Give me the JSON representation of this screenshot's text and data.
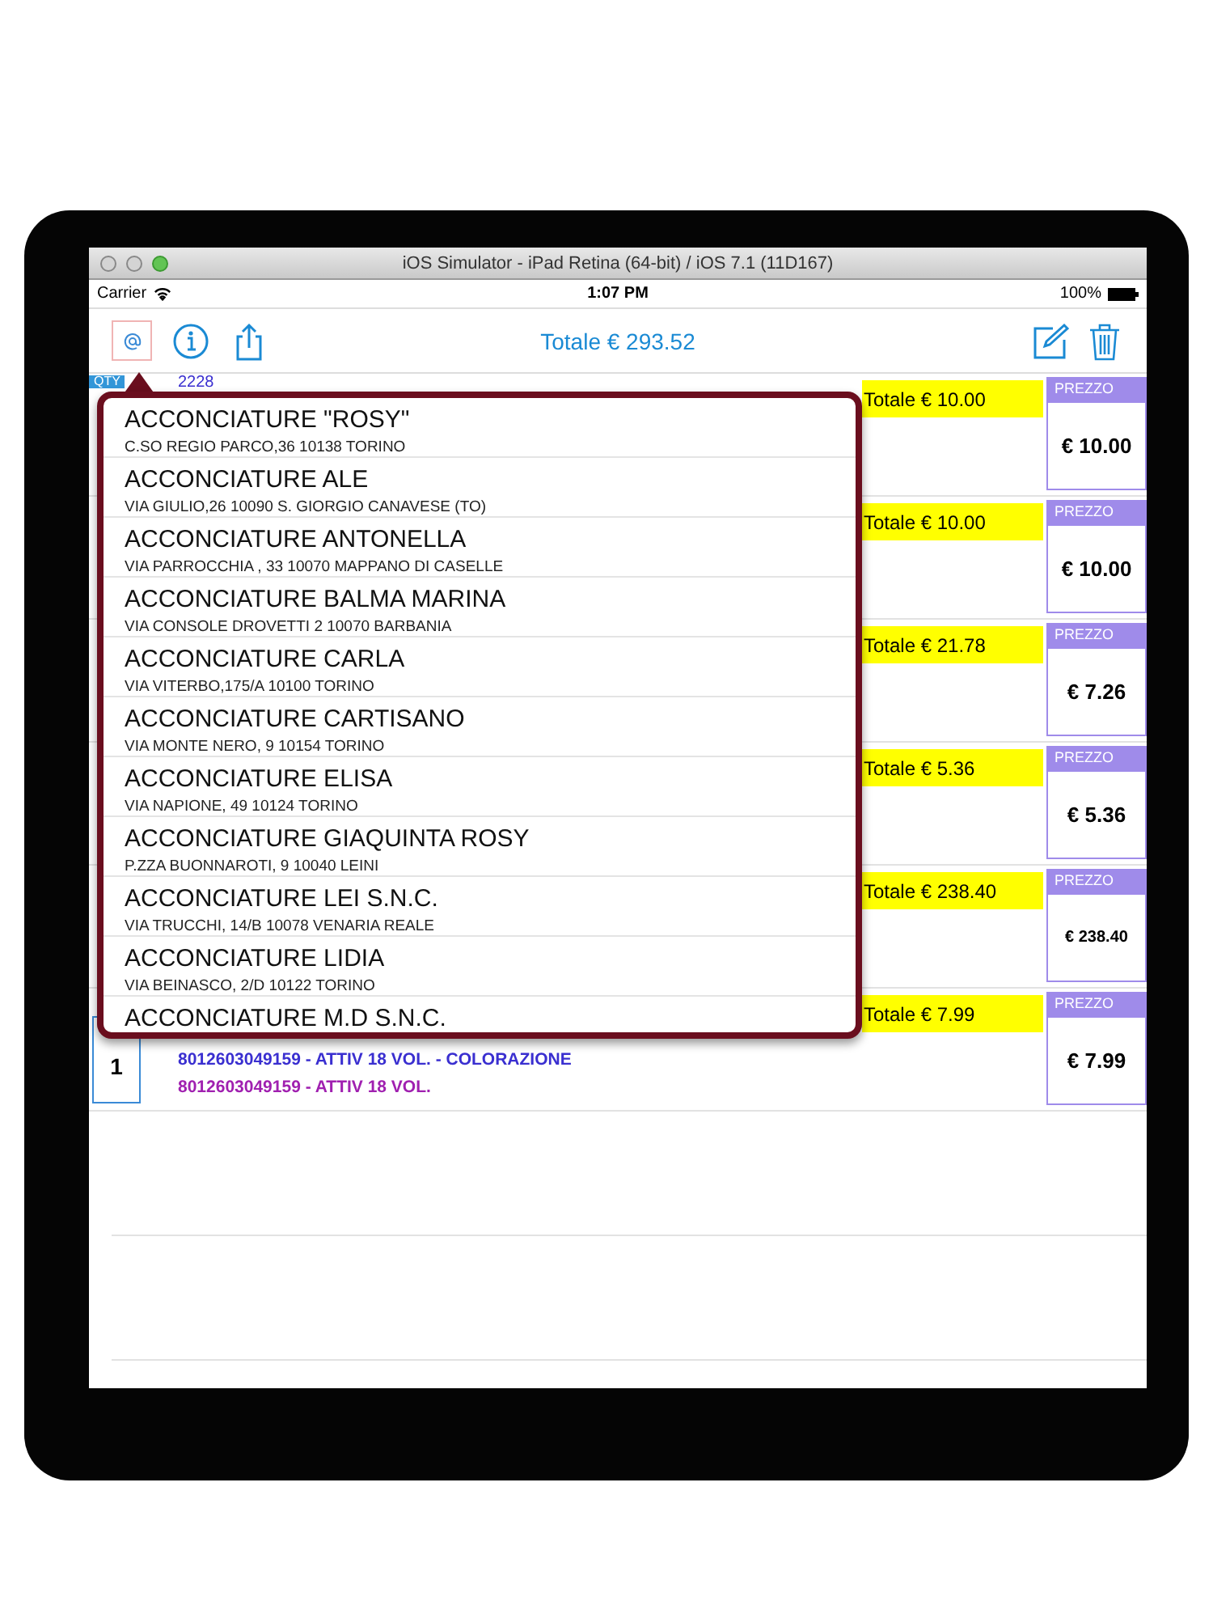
{
  "window": {
    "title": "iOS Simulator - iPad Retina (64-bit) / iOS 7.1 (11D167)"
  },
  "status_bar": {
    "carrier": "Carrier",
    "time": "1:07 PM",
    "battery": "100%"
  },
  "toolbar": {
    "title": "Totale € 293.52"
  },
  "rows": [
    {
      "qty_label": "QTY",
      "code": "2228",
      "total": "Totale € 10.00",
      "price_label": "PREZZO",
      "price": "€ 10.00"
    },
    {
      "total": "Totale € 10.00",
      "price_label": "PREZZO",
      "price": "€ 10.00"
    },
    {
      "total": "Totale € 21.78",
      "price_label": "PREZZO",
      "price": "€ 7.26"
    },
    {
      "total": "Totale € 5.36",
      "price_label": "PREZZO",
      "price": "€ 5.36"
    },
    {
      "total": "Totale € 238.40",
      "price_label": "PREZZO",
      "price": "€ 238.40"
    },
    {
      "qty": "1",
      "lines": [
        {
          "text": "8012603049159 - ATTIV 18 VOL. - COLORAZIONE",
          "color": "#3a2fd0"
        },
        {
          "text": "8012603049159  -  ATTIV 18 VOL.",
          "color": "#a020b0"
        }
      ],
      "total": "Totale € 7.99",
      "price_label": "PREZZO",
      "price": "€ 7.99"
    }
  ],
  "popover": {
    "items": [
      {
        "name": "ACCONCIATURE \"ROSY\"",
        "address": "C.SO REGIO PARCO,36 10138  TORINO"
      },
      {
        "name": "ACCONCIATURE ALE",
        "address": "VIA GIULIO,26 10090 S. GIORGIO CANAVESE (TO)"
      },
      {
        "name": "ACCONCIATURE ANTONELLA",
        "address": "VIA PARROCCHIA , 33 10070 MAPPANO DI CASELLE"
      },
      {
        "name": "ACCONCIATURE BALMA MARINA",
        "address": "VIA CONSOLE DROVETTI 2 10070 BARBANIA"
      },
      {
        "name": "ACCONCIATURE CARLA",
        "address": "VIA VITERBO,175/A 10100 TORINO"
      },
      {
        "name": "ACCONCIATURE CARTISANO",
        "address": "VIA MONTE NERO, 9 10154 TORINO"
      },
      {
        "name": "ACCONCIATURE ELISA",
        "address": "VIA NAPIONE, 49 10124 TORINO"
      },
      {
        "name": "ACCONCIATURE GIAQUINTA ROSY",
        "address": "P.ZZA BUONNAROTI, 9 10040 LEINI"
      },
      {
        "name": "ACCONCIATURE LEI S.N.C.",
        "address": "VIA TRUCCHI, 14/B 10078 VENARIA REALE"
      },
      {
        "name": "ACCONCIATURE LIDIA",
        "address": "VIA BEINASCO, 2/D 10122 TORINO"
      },
      {
        "name": "ACCONCIATURE M.D S.N.C."
      }
    ]
  }
}
